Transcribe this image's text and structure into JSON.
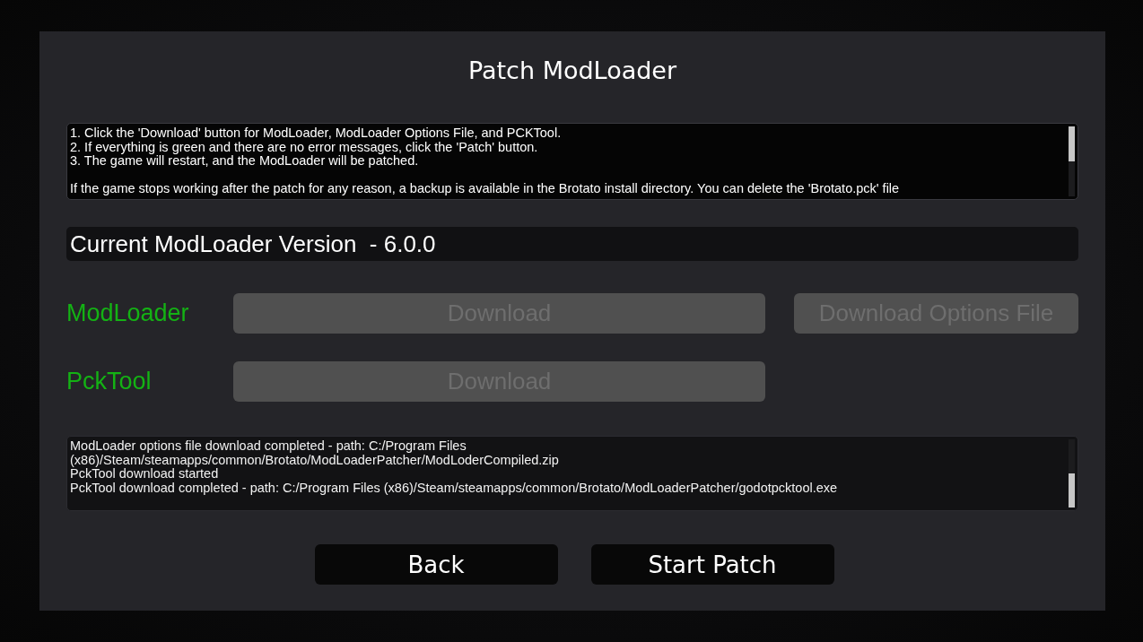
{
  "dialog": {
    "title": "Patch ModLoader"
  },
  "instructions": {
    "steps": [
      "1. Click the 'Download' button for ModLoader, ModLoader Options File, and PCKTool.",
      "2. If everything is green and there are no error messages, click the 'Patch' button.",
      "3. The game will restart, and the ModLoader will be patched."
    ],
    "note": "If the game stops working after the patch for any reason, a backup is available in the Brotato install directory. You can delete the 'Brotato.pck' file"
  },
  "version_bar": {
    "text": "Current ModLoader Version  - 6.0.0"
  },
  "components": [
    {
      "name": "ModLoader",
      "ready": true,
      "buttons": [
        {
          "label": "Download",
          "kind": "main",
          "disabled": true
        },
        {
          "label": "Download Options File",
          "kind": "extra",
          "disabled": true
        }
      ]
    },
    {
      "name": "PckTool",
      "ready": true,
      "buttons": [
        {
          "label": "Download",
          "kind": "main",
          "disabled": true
        }
      ]
    }
  ],
  "log": {
    "lines": [
      "ModLoader options file download completed - path: C:/Program Files",
      "(x86)/Steam/steamapps/common/Brotato/ModLoaderPatcher/ModLoderCompiled.zip",
      "PckTool download started",
      "PckTool download completed - path: C:/Program Files (x86)/Steam/steamapps/common/Brotato/ModLoaderPatcher/godotpcktool.exe"
    ]
  },
  "buttons": [
    {
      "label": "Back"
    },
    {
      "label": "Start Patch"
    }
  ]
}
